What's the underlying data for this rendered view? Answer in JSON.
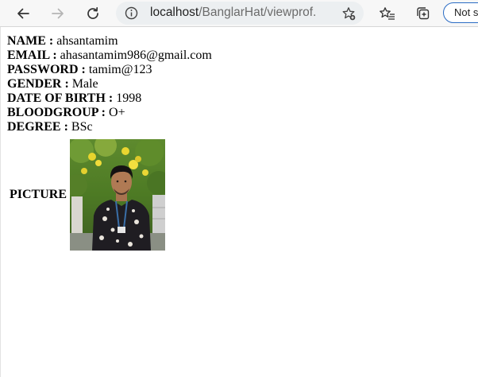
{
  "browser": {
    "url_host": "localhost",
    "url_path": "/BanglarHat/viewprof...",
    "security_label": "Not s",
    "icons": {
      "back": "back-arrow-icon",
      "forward": "forward-arrow-icon",
      "reload": "reload-icon",
      "info": "site-info-icon",
      "add_favorite": "add-favorite-icon",
      "favorites": "favorites-icon",
      "collections": "collections-icon"
    }
  },
  "profile": {
    "fields": [
      {
        "label": "NAME :",
        "value": "ahsantamim"
      },
      {
        "label": "EMAIL :",
        "value": "ahasantamim986@gmail.com"
      },
      {
        "label": "PASSWORD :",
        "value": "tamim@123"
      },
      {
        "label": "GENDER :",
        "value": "Male"
      },
      {
        "label": "DATE OF BIRTH :",
        "value": "1998"
      },
      {
        "label": "BLOODGROUP :",
        "value": "O+"
      },
      {
        "label": "DEGREE :",
        "value": "BSc"
      }
    ],
    "picture_label": "PICTURE"
  }
}
